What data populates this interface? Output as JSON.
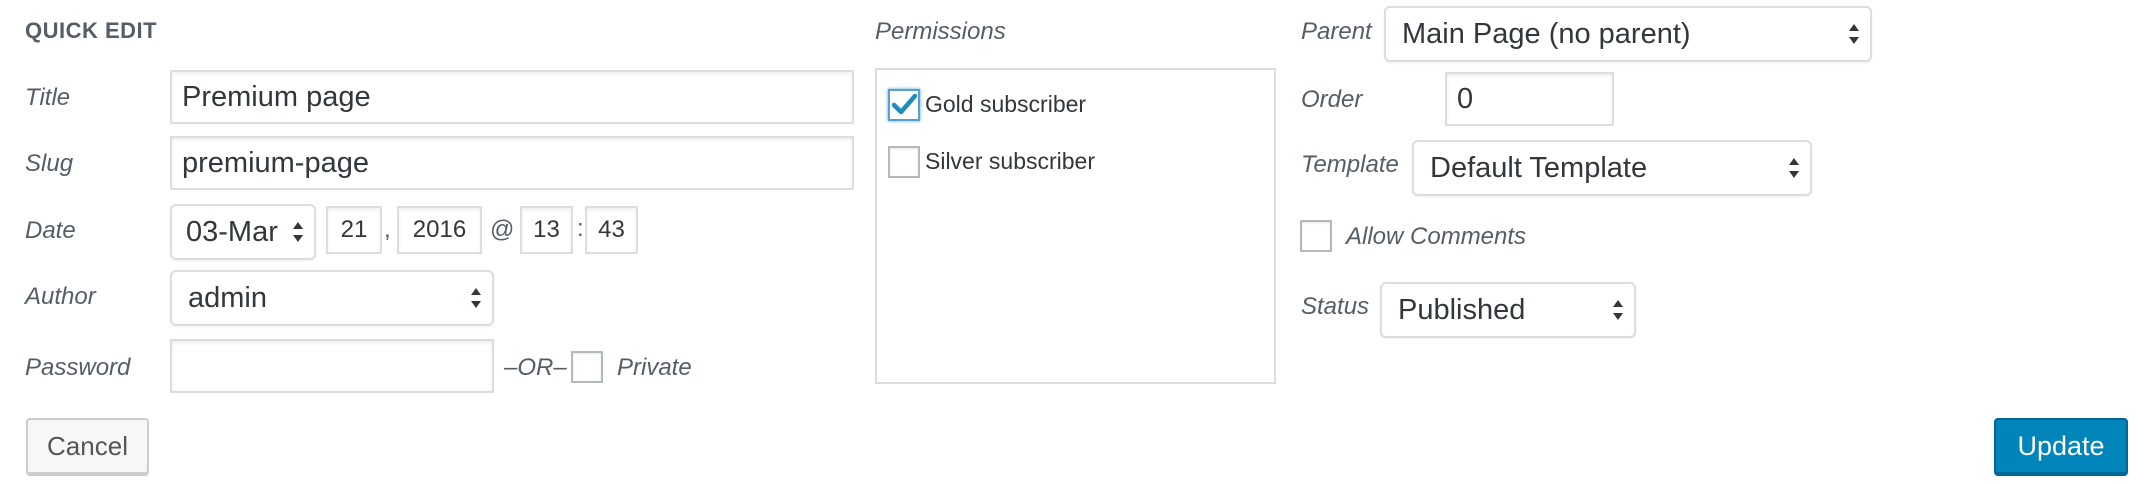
{
  "form": {
    "heading": "QUICK EDIT",
    "title_label": "Title",
    "title_value": "Premium page",
    "slug_label": "Slug",
    "slug_value": "premium-page",
    "date_label": "Date",
    "date": {
      "month": "03-Mar",
      "day": "21",
      "day_sep": ",",
      "year": "2016",
      "at_sep": "@",
      "hour": "13",
      "time_sep": ":",
      "minute": "43"
    },
    "author_label": "Author",
    "author_value": "admin",
    "password_label": "Password",
    "password_value": "",
    "or_text": "–OR–",
    "private_label": "Private",
    "private_checked": false
  },
  "permissions": {
    "label": "Permissions",
    "items": [
      {
        "label": "Gold subscriber",
        "checked": true
      },
      {
        "label": "Silver subscriber",
        "checked": false
      }
    ]
  },
  "attributes": {
    "parent_label": "Parent",
    "parent_value": "Main Page (no parent)",
    "order_label": "Order",
    "order_value": "0",
    "template_label": "Template",
    "template_value": "Default Template",
    "allow_comments_label": "Allow Comments",
    "allow_comments_checked": false,
    "status_label": "Status",
    "status_value": "Published"
  },
  "buttons": {
    "cancel": "Cancel",
    "update": "Update"
  },
  "colors": {
    "primary": "#0085ba",
    "checkmark": "#1e8cbe"
  }
}
